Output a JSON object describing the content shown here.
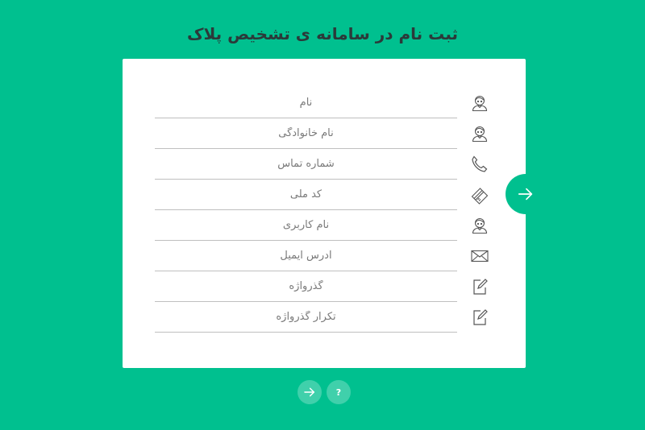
{
  "page": {
    "title": "ثبت نام در سامانه ی تشخیص پلاک"
  },
  "form": {
    "fields": [
      {
        "placeholder": "نام",
        "icon": "user-icon"
      },
      {
        "placeholder": "نام خانوادگی",
        "icon": "user-icon"
      },
      {
        "placeholder": "شماره تماس",
        "icon": "phone-icon"
      },
      {
        "placeholder": "کد ملی",
        "icon": "id-card-icon"
      },
      {
        "placeholder": "نام کاربری",
        "icon": "user-icon"
      },
      {
        "placeholder": "آدرس ایمیل",
        "icon": "envelope-icon"
      },
      {
        "placeholder": "گذرواژه",
        "icon": "edit-icon"
      },
      {
        "placeholder": "تکرار گذرواژه",
        "icon": "edit-icon"
      }
    ]
  },
  "controls": {
    "help_label": "?"
  },
  "colors": {
    "background": "#00c08f",
    "card": "#ffffff",
    "title": "#2b3a3a"
  }
}
